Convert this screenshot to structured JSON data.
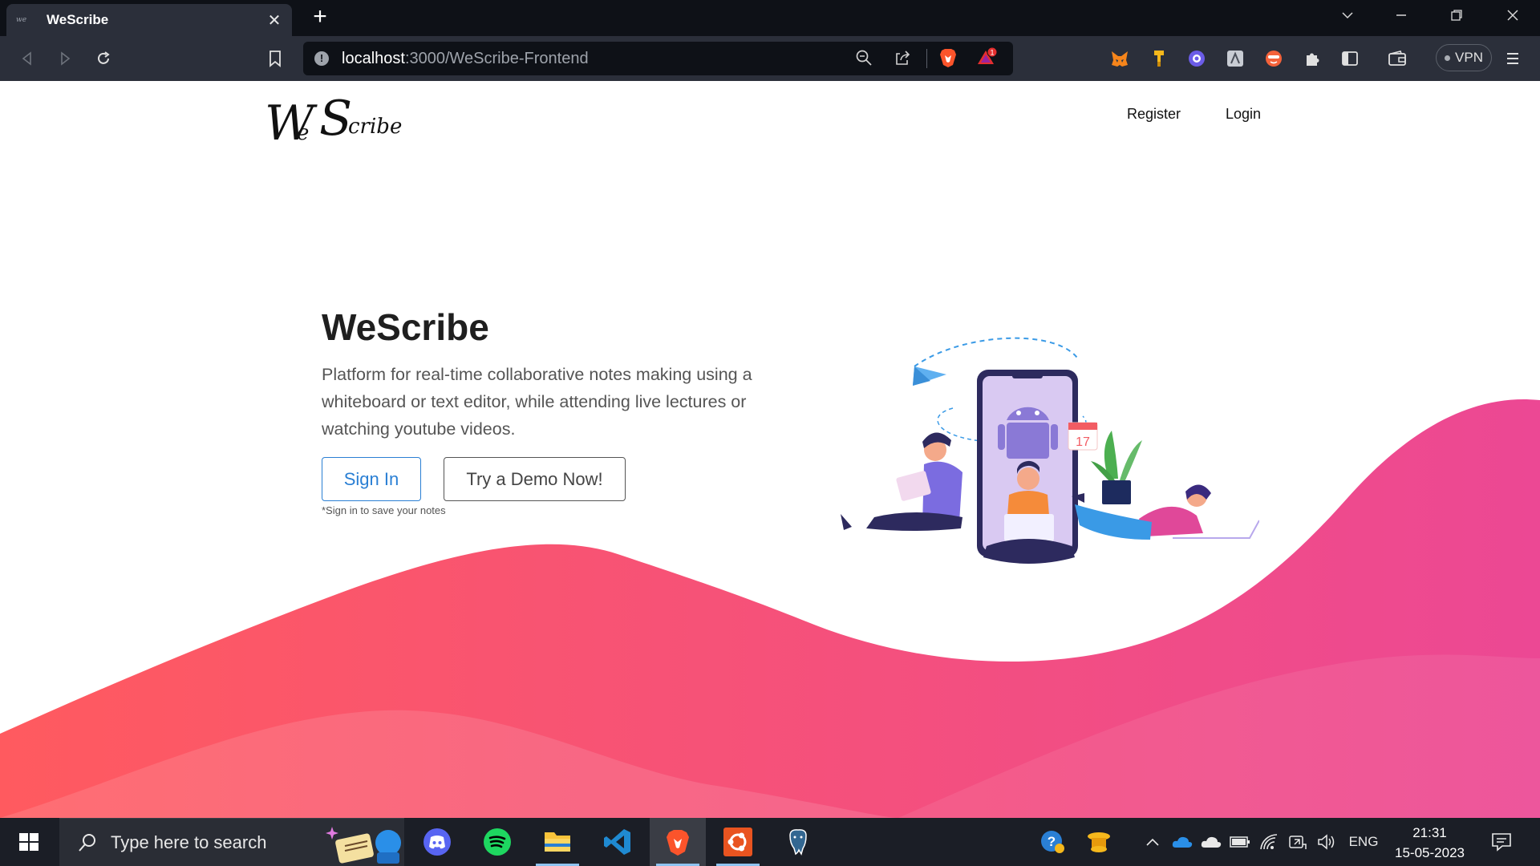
{
  "browser": {
    "tab_title": "WeScribe",
    "tab_favicon_text": "we",
    "tab_close_glyph": "✕",
    "new_tab_glyph": "+",
    "url_host": "localhost",
    "url_path": ":3000/WeScribe-Frontend",
    "info_glyph": "!",
    "vpn_label": "VPN",
    "notification_count": "1",
    "window_controls": [
      "chevron-down-icon",
      "minimize-icon",
      "restore-icon",
      "close-icon"
    ]
  },
  "page": {
    "logo_big_1": "W",
    "logo_small_1": "e",
    "logo_big_2": "S",
    "logo_small_2": "cribe",
    "nav": {
      "register": "Register",
      "login": "Login"
    },
    "hero": {
      "title": "WeScribe",
      "description": "Platform for real-time collaborative notes making using a whiteboard or text editor, while attending live lectures or watching youtube videos.",
      "signin_button": "Sign In",
      "demo_button": "Try a Demo Now!",
      "note": "*Sign in to save your notes"
    },
    "illustration": {
      "calendar_day": "17"
    },
    "colors": {
      "wave_start": "#ff5a5f",
      "wave_end": "#ec4894",
      "link_blue": "#2a7fd4"
    }
  },
  "taskbar": {
    "search_placeholder": "Type here to search",
    "apps": [
      "discord-icon",
      "spotify-icon",
      "file-explorer-icon",
      "vscode-icon",
      "brave-icon",
      "ubuntu-icon",
      "postgresql-icon"
    ],
    "language": "ENG",
    "time": "21:31",
    "date": "15-05-2023"
  }
}
